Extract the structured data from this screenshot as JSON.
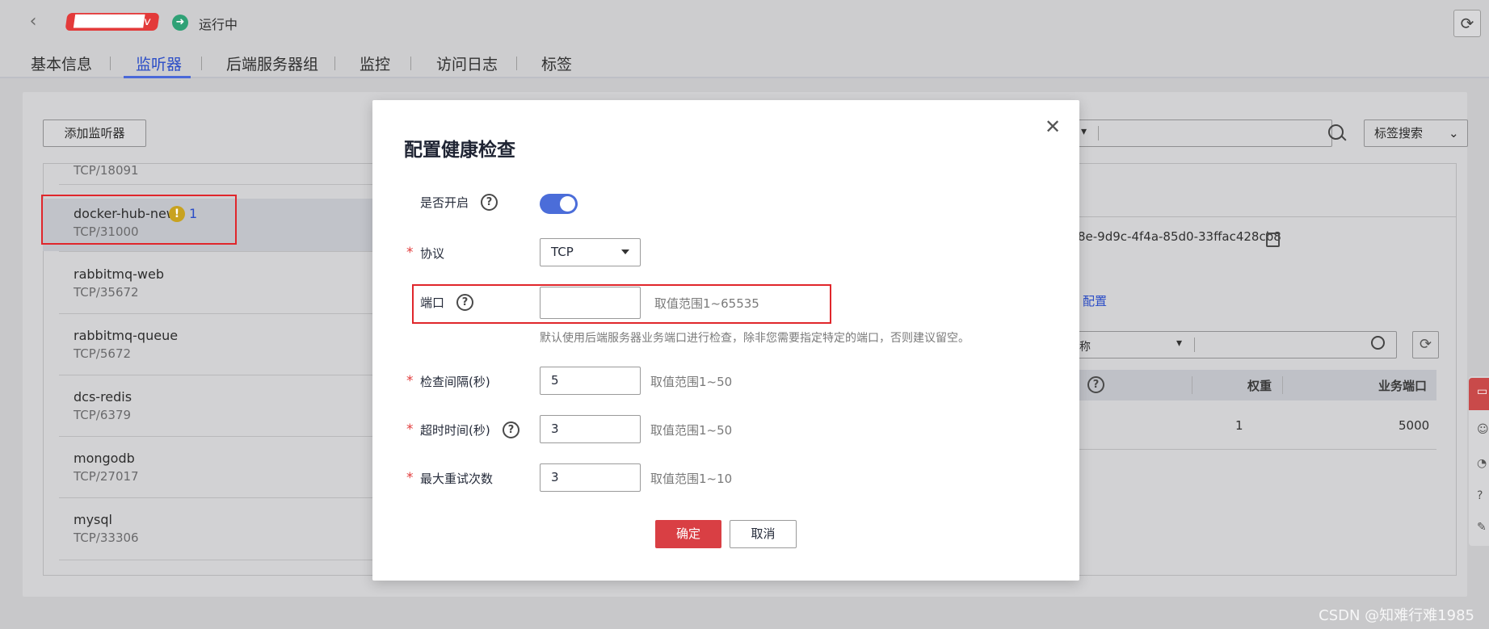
{
  "header": {
    "back_icon": "chevron-left-icon",
    "lb_name": "████████v",
    "status_icon": "arrow-right-circle-icon",
    "status_text": "运行中",
    "refresh_icon": "refresh-icon"
  },
  "tabs": [
    {
      "label": "基本信息"
    },
    {
      "label": "监听器"
    },
    {
      "label": "后端服务器组"
    },
    {
      "label": "监控"
    },
    {
      "label": "访问日志"
    },
    {
      "label": "标签"
    }
  ],
  "main": {
    "add_listener_label": "添加监听器",
    "listeners": [
      {
        "name": "",
        "sub": "TCP/18091"
      },
      {
        "name": "docker-hub-new",
        "sub": "TCP/31000",
        "warn_count": "1"
      },
      {
        "name": "rabbitmq-web",
        "sub": "TCP/35672"
      },
      {
        "name": "rabbitmq-queue",
        "sub": "TCP/5672"
      },
      {
        "name": "dcs-redis",
        "sub": "TCP/6379"
      },
      {
        "name": "mongodb",
        "sub": "TCP/27017"
      },
      {
        "name": "mysql",
        "sub": "TCP/33306"
      }
    ],
    "right": {
      "tag_search_label": "标签搜索",
      "id_fragment": "8e-9d9c-4f4a-85d0-33ffac428cb8",
      "config_link": "配置",
      "filter_fragment": "称",
      "table_headers": {
        "weight": "权重",
        "port": "业务端口"
      },
      "table_row": {
        "weight": "1",
        "port": "5000"
      }
    }
  },
  "modal": {
    "title": "配置健康检查",
    "close_icon": "close-icon",
    "enabled": {
      "label": "是否开启",
      "value": true
    },
    "protocol": {
      "label": "协议",
      "value": "TCP"
    },
    "port": {
      "label": "端口",
      "value": "",
      "hint": "取值范围1~65535",
      "note": "默认使用后端服务器业务端口进行检查，除非您需要指定特定的端口，否则建议留空。"
    },
    "interval": {
      "label": "检查间隔(秒)",
      "value": "5",
      "hint": "取值范围1~50"
    },
    "timeout": {
      "label": "超时时间(秒)",
      "value": "3",
      "hint": "取值范围1~50"
    },
    "retries": {
      "label": "最大重试次数",
      "value": "3",
      "hint": "取值范围1~10"
    },
    "ok_label": "确定",
    "cancel_label": "取消"
  },
  "watermark": "CSDN @知难行难1985"
}
